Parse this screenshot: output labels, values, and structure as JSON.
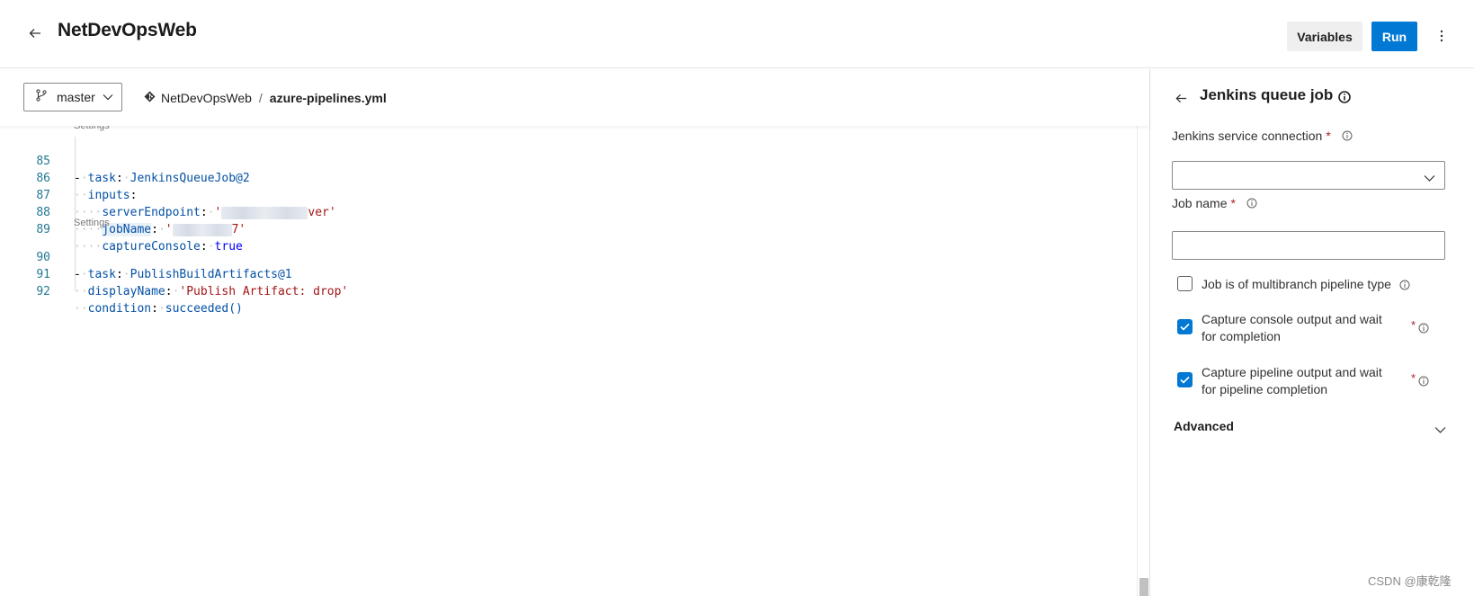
{
  "header": {
    "title": "NetDevOpsWeb",
    "variables_label": "Variables",
    "run_label": "Run"
  },
  "editor": {
    "branch": "master",
    "repo": "NetDevOpsWeb",
    "separator": "/",
    "file": "azure-pipelines.yml",
    "settings_label": "Settings",
    "lines": [
      {
        "num": "85"
      },
      {
        "num": "86"
      },
      {
        "num": "87"
      },
      {
        "num": "88"
      },
      {
        "num": "89"
      },
      {
        "num": "90"
      },
      {
        "num": "91"
      },
      {
        "num": "92"
      }
    ],
    "tokens": {
      "dash": "-",
      "task_key": "task",
      "colon": ":",
      "jenkins_task": "JenkinsQueueJob@2",
      "inputs_key": "inputs",
      "server_key": "serverEndpoint",
      "server_val_start": "'",
      "server_val_end": "ver'",
      "job_key": "jobName",
      "job_val_start": "'",
      "job_val_end": "7'",
      "capture_key": "captureConsole",
      "capture_val": "true",
      "publish_task": "PublishBuildArtifacts@1",
      "display_key": "displayName",
      "display_val": "'Publish Artifact: drop'",
      "condition_key": "condition",
      "condition_val": "succeeded()"
    }
  },
  "panel": {
    "title": "Jenkins queue job",
    "service_connection_label": "Jenkins service connection",
    "required_mark": "*",
    "job_name_label": "Job name",
    "job_name_value": "",
    "multibranch_label": "Job is of multibranch pipeline type",
    "capture_console_label": "Capture console output and wait for completion",
    "capture_pipeline_label": "Capture pipeline output and wait for pipeline completion",
    "advanced_label": "Advanced",
    "multibranch_checked": false,
    "capture_console_checked": true,
    "capture_pipeline_checked": true
  },
  "watermark": "CSDN @康乾隆",
  "colors": {
    "accent": "#0078d4",
    "required": "#a4262c"
  }
}
